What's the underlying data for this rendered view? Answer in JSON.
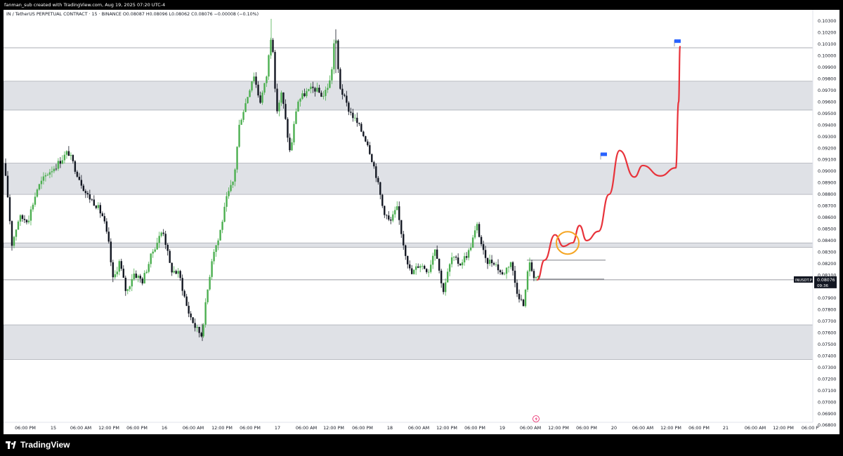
{
  "header": {
    "attribution": "fanman_sub created with TradingView.com, Aug 19, 2025 07:20 UTC-4",
    "symbol_line": "IN / TetherUS PERPETUAL CONTRACT · 15 · BINANCE  O0.08087  H0.08096  L0.08062  C0.08076  −0.00008 (−0.10%)"
  },
  "footer": {
    "logo_text": "TradingView"
  },
  "colors": {
    "up_candle": "#4caf50",
    "down_candle": "#131722",
    "forecast_path": "#e8333b",
    "highlight_circle": "#f5a623",
    "flag": "#2962ff",
    "zone_fill": "#d1d4dc",
    "price_label_bg": "#131722"
  },
  "price_label": {
    "symbol": "INUSDT.P",
    "price": "0.08076",
    "countdown": "09:36"
  },
  "chart_data": {
    "type": "candlestick",
    "title": "",
    "y_axis": {
      "range": [
        0.0685,
        0.1035
      ],
      "tick_labels": [
        "0.10300",
        "0.10200",
        "0.10100",
        "0.10000",
        "0.09900",
        "0.09800",
        "0.09700",
        "0.09600",
        "0.09500",
        "0.09400",
        "0.09300",
        "0.09200",
        "0.09100",
        "0.09000",
        "0.08900",
        "0.08800",
        "0.08700",
        "0.08600",
        "0.08500",
        "0.08400",
        "0.08300",
        "0.08200",
        "0.08100",
        "0.08000",
        "0.07900",
        "0.07800",
        "0.07700",
        "0.07600",
        "0.07500",
        "0.07400",
        "0.07300",
        "0.07200",
        "0.07100",
        "0.07000",
        "0.06900",
        "0.06800"
      ]
    },
    "x_axis": {
      "tick_labels": [
        "06:00 PM",
        "15",
        "06:00 AM",
        "12:00 PM",
        "06:00 PM",
        "16",
        "06:00 AM",
        "12:00 PM",
        "06:00 PM",
        "17",
        "06:00 AM",
        "12:00 PM",
        "06:00 PM",
        "18",
        "06:00 AM",
        "12:00 PM",
        "06:00 PM",
        "19",
        "06:00 AM",
        "12:00 PM",
        "06:00 PM",
        "20",
        "06:00 AM",
        "12:00 PM",
        "06:00 PM",
        "21",
        "06:00 AM",
        "12:00 PM",
        "06:00 P"
      ]
    },
    "price_path": [
      {
        "time": 0,
        "price": 0.0907
      },
      {
        "time": 5,
        "price": 0.0885
      },
      {
        "time": 12,
        "price": 0.0837
      },
      {
        "time": 22,
        "price": 0.086
      },
      {
        "time": 35,
        "price": 0.0858
      },
      {
        "time": 48,
        "price": 0.0885
      },
      {
        "time": 62,
        "price": 0.0898
      },
      {
        "time": 75,
        "price": 0.0905
      },
      {
        "time": 92,
        "price": 0.0917
      },
      {
        "time": 105,
        "price": 0.0898
      },
      {
        "time": 118,
        "price": 0.088
      },
      {
        "time": 132,
        "price": 0.0871
      },
      {
        "time": 142,
        "price": 0.086
      },
      {
        "time": 150,
        "price": 0.0836
      },
      {
        "time": 156,
        "price": 0.0805
      },
      {
        "time": 165,
        "price": 0.0822
      },
      {
        "time": 175,
        "price": 0.0794
      },
      {
        "time": 185,
        "price": 0.0812
      },
      {
        "time": 198,
        "price": 0.0805
      },
      {
        "time": 212,
        "price": 0.083
      },
      {
        "time": 227,
        "price": 0.085
      },
      {
        "time": 238,
        "price": 0.0815
      },
      {
        "time": 250,
        "price": 0.0811
      },
      {
        "time": 262,
        "price": 0.078
      },
      {
        "time": 273,
        "price": 0.0765
      },
      {
        "time": 282,
        "price": 0.0758
      },
      {
        "time": 290,
        "price": 0.0795
      },
      {
        "time": 298,
        "price": 0.083
      },
      {
        "time": 306,
        "price": 0.0841
      },
      {
        "time": 318,
        "price": 0.0877
      },
      {
        "time": 328,
        "price": 0.0893
      },
      {
        "time": 336,
        "price": 0.0942
      },
      {
        "time": 346,
        "price": 0.0962
      },
      {
        "time": 356,
        "price": 0.0985
      },
      {
        "time": 365,
        "price": 0.096
      },
      {
        "time": 374,
        "price": 0.098
      },
      {
        "time": 382,
        "price": 0.1025
      },
      {
        "time": 388,
        "price": 0.095
      },
      {
        "time": 396,
        "price": 0.0968
      },
      {
        "time": 408,
        "price": 0.0915
      },
      {
        "time": 418,
        "price": 0.096
      },
      {
        "time": 430,
        "price": 0.0968
      },
      {
        "time": 442,
        "price": 0.0972
      },
      {
        "time": 455,
        "price": 0.0965
      },
      {
        "time": 466,
        "price": 0.098
      },
      {
        "time": 472,
        "price": 0.1022
      },
      {
        "time": 478,
        "price": 0.0975
      },
      {
        "time": 490,
        "price": 0.0955
      },
      {
        "time": 505,
        "price": 0.094
      },
      {
        "time": 518,
        "price": 0.0925
      },
      {
        "time": 530,
        "price": 0.0898
      },
      {
        "time": 540,
        "price": 0.0868
      },
      {
        "time": 550,
        "price": 0.0855
      },
      {
        "time": 560,
        "price": 0.0868
      },
      {
        "time": 570,
        "price": 0.0835
      },
      {
        "time": 580,
        "price": 0.081
      },
      {
        "time": 592,
        "price": 0.082
      },
      {
        "time": 605,
        "price": 0.0814
      },
      {
        "time": 615,
        "price": 0.0836
      },
      {
        "time": 625,
        "price": 0.0795
      },
      {
        "time": 638,
        "price": 0.0825
      },
      {
        "time": 650,
        "price": 0.082
      },
      {
        "time": 662,
        "price": 0.083
      },
      {
        "time": 674,
        "price": 0.0853
      },
      {
        "time": 686,
        "price": 0.0822
      },
      {
        "time": 698,
        "price": 0.0822
      },
      {
        "time": 710,
        "price": 0.081
      },
      {
        "time": 722,
        "price": 0.0822
      },
      {
        "time": 730,
        "price": 0.0798
      },
      {
        "time": 741,
        "price": 0.0782
      },
      {
        "time": 747,
        "price": 0.0822
      },
      {
        "time": 755,
        "price": 0.081
      },
      {
        "time": 763,
        "price": 0.0806
      }
    ],
    "zones": [
      {
        "top": 0.0978,
        "bottom": 0.0953
      },
      {
        "top": 0.0907,
        "bottom": 0.088
      },
      {
        "top": 0.0838,
        "bottom": 0.0834
      },
      {
        "top": 0.0767,
        "bottom": 0.0737
      }
    ],
    "horizontal_levels": [
      0.1007,
      0.0806
    ],
    "short_levels": [
      0.0823,
      0.0806
    ],
    "forecast_path": [
      0.0806,
      0.0823,
      0.0845,
      0.0835,
      0.0838,
      0.0853,
      0.084,
      0.0848,
      0.088,
      0.0918,
      0.0895,
      0.0905,
      0.0896,
      0.0903,
      0.096,
      0.1008
    ],
    "highlight_price": 0.0838,
    "flags": [
      0.0912,
      0.101
    ]
  }
}
